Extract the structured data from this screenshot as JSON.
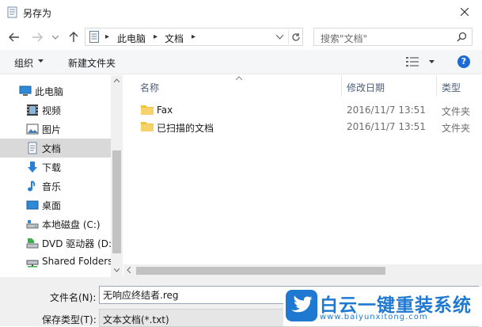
{
  "window": {
    "title": "另存为",
    "close_icon": "close-icon"
  },
  "nav": {
    "back_icon": "back-arrow-icon",
    "forward_icon": "forward-arrow-icon",
    "recent_icon": "chevron-down-icon",
    "up_icon": "up-arrow-icon"
  },
  "address": {
    "crumbs": [
      "此电脑",
      "文档"
    ],
    "dropdown_icon": "chevron-down-icon",
    "refresh_icon": "refresh-icon"
  },
  "search": {
    "placeholder": "搜索\"文档\"",
    "icon": "search-icon"
  },
  "toolbar": {
    "organize": "组织",
    "new_folder": "新建文件夹",
    "view_icon": "view-options-icon",
    "help": "?"
  },
  "sidebar": {
    "items": [
      {
        "label": "此电脑",
        "icon": "computer-icon"
      },
      {
        "label": "视频",
        "icon": "video-icon"
      },
      {
        "label": "图片",
        "icon": "pictures-icon"
      },
      {
        "label": "文档",
        "icon": "documents-icon",
        "selected": true
      },
      {
        "label": "下载",
        "icon": "download-icon"
      },
      {
        "label": "音乐",
        "icon": "music-icon"
      },
      {
        "label": "桌面",
        "icon": "desktop-icon"
      },
      {
        "label": "本地磁盘 (C:)",
        "icon": "local-disk-icon"
      },
      {
        "label": "DVD 驱动器 (D:",
        "icon": "dvd-drive-icon"
      },
      {
        "label": "Shared Folders",
        "icon": "network-drive-icon"
      }
    ]
  },
  "columns": {
    "name": "名称",
    "modified": "修改日期",
    "type": "类型"
  },
  "files": [
    {
      "name": "Fax",
      "modified": "2016/11/7 13:51",
      "type": "文件夹",
      "icon": "folder-icon"
    },
    {
      "name": "已扫描的文档",
      "modified": "2016/11/7 13:51",
      "type": "文件夹",
      "icon": "folder-icon"
    }
  ],
  "form": {
    "filename_label": "文件名(N):",
    "filename_value": "无响应终结者.reg",
    "filetype_label": "保存类型(T):",
    "filetype_value": "文本文档(*.txt)"
  },
  "watermark": {
    "brand": "白云一键重装系统",
    "url": "www.baiyunxitong.com"
  },
  "colors": {
    "accent": "#1c6bd4",
    "folder": "#f0c33c",
    "selected_bg": "#d9d9d9",
    "brand": "#1f79d1"
  }
}
